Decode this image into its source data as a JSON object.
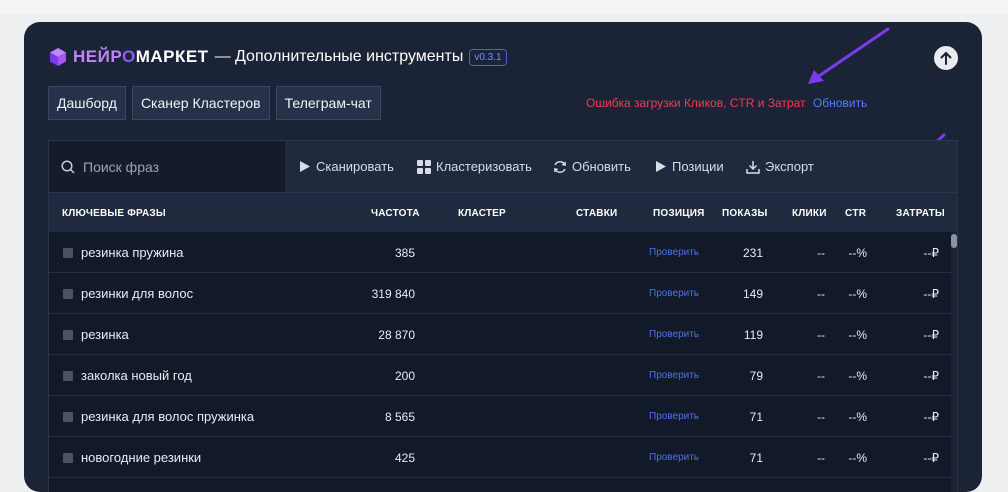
{
  "header": {
    "brand_pre": "НЕЙР",
    "brand_o": "О",
    "brand_post": "МАРКЕТ",
    "subtitle": "— Дополнительные инструменты",
    "version": "v0.3.1"
  },
  "tabs": [
    {
      "label": "Дашборд"
    },
    {
      "label": "Сканер Кластеров"
    },
    {
      "label": "Телеграм-чат"
    }
  ],
  "status": {
    "error": "Ошибка загрузки Кликов, CTR и Затрат",
    "refresh": "Обновить"
  },
  "toolbar": {
    "search_placeholder": "Поиск фраз",
    "scan": "Сканировать",
    "cluster": "Кластеризовать",
    "refresh": "Обновить",
    "positions": "Позиции",
    "export": "Экспорт"
  },
  "table": {
    "headers": {
      "keywords": "КЛЮЧЕВЫЕ ФРАЗЫ",
      "frequency": "ЧАСТОТА",
      "cluster": "КЛАСТЕР",
      "bids": "СТАВКИ",
      "position": "ПОЗИЦИЯ",
      "impressions": "ПОКАЗЫ",
      "clicks": "КЛИКИ",
      "ctr": "CTR",
      "costs": "ЗАТРАТЫ"
    },
    "rows": [
      {
        "keyword": "резинка пружина",
        "frequency": "385",
        "position": "Проверить",
        "impressions": "231",
        "clicks": "--",
        "ctr": "--%",
        "costs": "--₽"
      },
      {
        "keyword": "резинки для волос",
        "frequency": "319 840",
        "position": "Проверить",
        "impressions": "149",
        "clicks": "--",
        "ctr": "--%",
        "costs": "--₽"
      },
      {
        "keyword": "резинка",
        "frequency": "28 870",
        "position": "Проверить",
        "impressions": "119",
        "clicks": "--",
        "ctr": "--%",
        "costs": "--₽"
      },
      {
        "keyword": "заколка новый год",
        "frequency": "200",
        "position": "Проверить",
        "impressions": "79",
        "clicks": "--",
        "ctr": "--%",
        "costs": "--₽"
      },
      {
        "keyword": "резинка для волос пружинка",
        "frequency": "8 565",
        "position": "Проверить",
        "impressions": "71",
        "clicks": "--",
        "ctr": "--%",
        "costs": "--₽"
      },
      {
        "keyword": "новогодние резинки",
        "frequency": "425",
        "position": "Проверить",
        "impressions": "71",
        "clicks": "--",
        "ctr": "--%",
        "costs": "--₽"
      }
    ]
  },
  "colors": {
    "panel_bg": "#1b2436",
    "error": "#ef3b52",
    "link": "#4f7ff7",
    "annotation_arrow": "#7c3aed"
  }
}
